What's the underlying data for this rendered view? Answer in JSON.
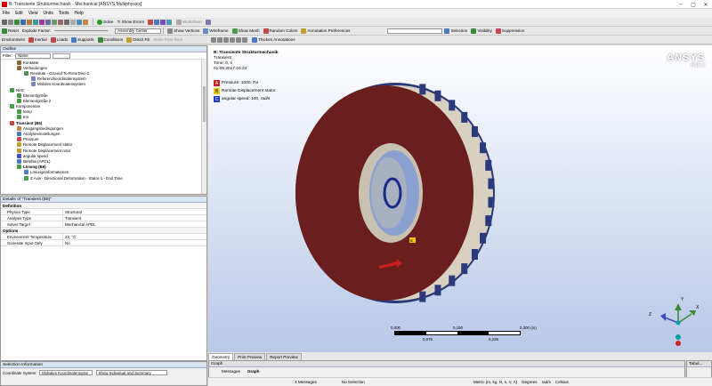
{
  "window": {
    "title": "B: Transiente Strukturmechanik - Mechanical [ANSYS Multiphysics]",
    "controls": [
      "–",
      "▢",
      "✕"
    ]
  },
  "menubar": [
    "File",
    "Edit",
    "View",
    "Units",
    "Tools",
    "Help"
  ],
  "toolbar1": {
    "solve": "Solve",
    "show_errors": "?/ Show Errors",
    "worksheet": "Worksheet"
  },
  "toolbar2": {
    "explode_factor": "Explode Factor:",
    "assembly_center": "Assembly Center"
  },
  "toolbar3": {
    "reset": "Reset",
    "show_vertices": "Show Vertices",
    "wireframe": "Wireframe",
    "show_mesh": "Show Mesh",
    "random_colors": "Random Colors",
    "annotation_prefs": "Annotation Preferences",
    "selection": "Selection",
    "visibility": "Visibility",
    "suppression": "Suppression"
  },
  "toolbar4": {
    "edge_coloring": "Edge Coloring",
    "thicken_annotations": "Thicken Annotations"
  },
  "context_bar": {
    "environment": "Environment",
    "inertial": "Inertial",
    "loads": "Loads",
    "supports": "Supports",
    "conditions": "Conditions",
    "direct_fe": "Direct FE",
    "mass_flow_rate": "Mass Flow Rate"
  },
  "outline": {
    "title": "Outline",
    "filter_label": "Filter:",
    "filter_value": "Name",
    "items": [
      {
        "label": "Kontakte",
        "indent": 2,
        "color": "#8a6a3a"
      },
      {
        "label": "Verbindungen",
        "indent": 2,
        "color": "#8a6a3a"
      },
      {
        "label": "Revolute - Ground To RotorDisc-2",
        "indent": 3,
        "color": "#5a8a5a"
      },
      {
        "label": "Referenzkoordinatensystem",
        "indent": 4,
        "color": "#7a8ac0"
      },
      {
        "label": "Mobiles Koordinatensystem",
        "indent": 4,
        "color": "#7a8ac0"
      },
      {
        "label": "Netz",
        "indent": 1,
        "color": "#4a9a4a"
      },
      {
        "label": "Elementgröße",
        "indent": 2,
        "color": "#4a9a4a"
      },
      {
        "label": "Elementgröße 2",
        "indent": 2,
        "color": "#4a9a4a"
      },
      {
        "label": "Komponenten",
        "indent": 1,
        "color": "#4a9a4a"
      },
      {
        "label": "temp",
        "indent": 2,
        "color": "#4a9a4a"
      },
      {
        "label": "tmr",
        "indent": 2,
        "color": "#4a9a4a"
      },
      {
        "label": "Transient (B5)",
        "indent": 1,
        "color": "#c04a4a",
        "bold": true
      },
      {
        "label": "Ausgangsbedingungen",
        "indent": 2,
        "color": "#c08a4a"
      },
      {
        "label": "Analyseeinstellungen",
        "indent": 2,
        "color": "#4a7ac0"
      },
      {
        "label": "Pressure",
        "indent": 2,
        "color": "#c04a4a"
      },
      {
        "label": "Remote Displacement stator",
        "indent": 2,
        "color": "#c0a030"
      },
      {
        "label": "Remote Displacement rotor",
        "indent": 2,
        "color": "#c0a030"
      },
      {
        "label": "angular speed",
        "indent": 2,
        "color": "#4a4ac0"
      },
      {
        "label": "Befehle (APDL)",
        "indent": 2,
        "color": "#4a7ac0"
      },
      {
        "label": "Lösung (B6)",
        "indent": 2,
        "color": "#4a9a4a",
        "bold": true
      },
      {
        "label": "Lösungsinformationen",
        "indent": 3,
        "color": "#4a7ac0"
      },
      {
        "label": "Z Axis - Directional Deformation - Stator-1 - End Time",
        "indent": 3,
        "color": "#4a9a4a"
      }
    ]
  },
  "details": {
    "title": "Details of \"Transient (B5)\"",
    "sections": [
      {
        "name": "Definition",
        "rows": [
          {
            "key": "Physics Type",
            "value": "Structural"
          },
          {
            "key": "Analysis Type",
            "value": "Transient"
          },
          {
            "key": "Solver Target",
            "value": "Mechanical APDL"
          }
        ]
      },
      {
        "name": "Options",
        "rows": [
          {
            "key": "Environment Temperature",
            "value": "22, °C"
          },
          {
            "key": "Generate Input Only",
            "value": "No"
          }
        ]
      }
    ]
  },
  "selection_info": {
    "title": "Selection Information",
    "coordinate_label": "Coordinate System:",
    "coordinate_value": "Globales Koordinatensyste",
    "show_value": "Show Individual and Summary"
  },
  "viewport": {
    "header_title": "B: Transiente Strukturmechanik",
    "header_sub": "Transient",
    "header_time": "Time: 0, s",
    "header_date": "01.05.2017 04:24",
    "legend": [
      {
        "letter": "A",
        "label": "Pressure: 1000, Pa",
        "color": "#cc2020"
      },
      {
        "letter": "B",
        "label": "Remote Displacement stator",
        "color": "#e8c800"
      },
      {
        "letter": "C",
        "label": "angular speed: 100, rad/s",
        "color": "#2040c0"
      }
    ],
    "brand": "ANSYS",
    "version": "R16.2",
    "scale_top": [
      "0,000",
      "0,150",
      "0,300 (m)"
    ],
    "scale_bottom": [
      "0,075",
      "0,225"
    ],
    "axis_labels": [
      "Z",
      "X",
      "Y"
    ]
  },
  "viewtabs": [
    "Geometry",
    "Print Preview",
    "Report Preview"
  ],
  "graph": {
    "title": "Graph",
    "tabs": [
      "Messages",
      "Graph"
    ]
  },
  "tabular": {
    "title": "Tabul..."
  },
  "statusbar": {
    "messages": "3 Messages",
    "selection": "No Selection",
    "units": "Metric (m, kg, N, s, V, A)",
    "degrees": "Degrees",
    "rads": "rad/s",
    "temp": "Celsius"
  }
}
